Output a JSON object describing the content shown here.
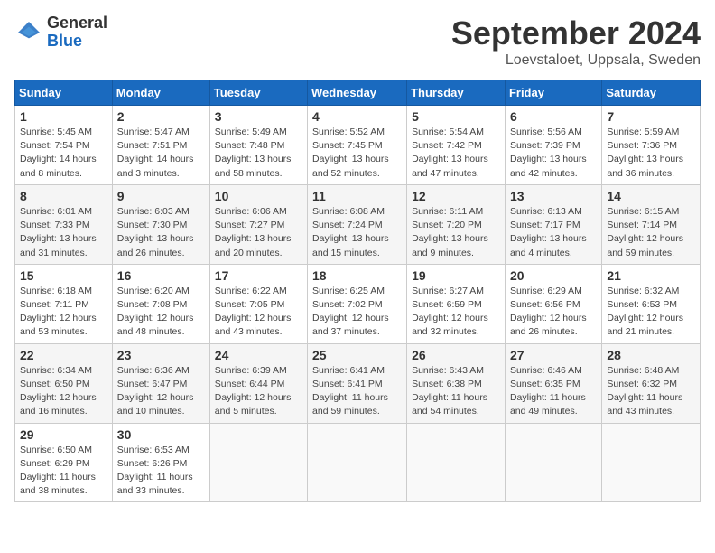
{
  "header": {
    "logo_line1": "General",
    "logo_line2": "Blue",
    "month_title": "September 2024",
    "location": "Loevstaloet, Uppsala, Sweden"
  },
  "calendar": {
    "days_of_week": [
      "Sunday",
      "Monday",
      "Tuesday",
      "Wednesday",
      "Thursday",
      "Friday",
      "Saturday"
    ],
    "weeks": [
      [
        {
          "day": "1",
          "info": "Sunrise: 5:45 AM\nSunset: 7:54 PM\nDaylight: 14 hours\nand 8 minutes."
        },
        {
          "day": "2",
          "info": "Sunrise: 5:47 AM\nSunset: 7:51 PM\nDaylight: 14 hours\nand 3 minutes."
        },
        {
          "day": "3",
          "info": "Sunrise: 5:49 AM\nSunset: 7:48 PM\nDaylight: 13 hours\nand 58 minutes."
        },
        {
          "day": "4",
          "info": "Sunrise: 5:52 AM\nSunset: 7:45 PM\nDaylight: 13 hours\nand 52 minutes."
        },
        {
          "day": "5",
          "info": "Sunrise: 5:54 AM\nSunset: 7:42 PM\nDaylight: 13 hours\nand 47 minutes."
        },
        {
          "day": "6",
          "info": "Sunrise: 5:56 AM\nSunset: 7:39 PM\nDaylight: 13 hours\nand 42 minutes."
        },
        {
          "day": "7",
          "info": "Sunrise: 5:59 AM\nSunset: 7:36 PM\nDaylight: 13 hours\nand 36 minutes."
        }
      ],
      [
        {
          "day": "8",
          "info": "Sunrise: 6:01 AM\nSunset: 7:33 PM\nDaylight: 13 hours\nand 31 minutes."
        },
        {
          "day": "9",
          "info": "Sunrise: 6:03 AM\nSunset: 7:30 PM\nDaylight: 13 hours\nand 26 minutes."
        },
        {
          "day": "10",
          "info": "Sunrise: 6:06 AM\nSunset: 7:27 PM\nDaylight: 13 hours\nand 20 minutes."
        },
        {
          "day": "11",
          "info": "Sunrise: 6:08 AM\nSunset: 7:24 PM\nDaylight: 13 hours\nand 15 minutes."
        },
        {
          "day": "12",
          "info": "Sunrise: 6:11 AM\nSunset: 7:20 PM\nDaylight: 13 hours\nand 9 minutes."
        },
        {
          "day": "13",
          "info": "Sunrise: 6:13 AM\nSunset: 7:17 PM\nDaylight: 13 hours\nand 4 minutes."
        },
        {
          "day": "14",
          "info": "Sunrise: 6:15 AM\nSunset: 7:14 PM\nDaylight: 12 hours\nand 59 minutes."
        }
      ],
      [
        {
          "day": "15",
          "info": "Sunrise: 6:18 AM\nSunset: 7:11 PM\nDaylight: 12 hours\nand 53 minutes."
        },
        {
          "day": "16",
          "info": "Sunrise: 6:20 AM\nSunset: 7:08 PM\nDaylight: 12 hours\nand 48 minutes."
        },
        {
          "day": "17",
          "info": "Sunrise: 6:22 AM\nSunset: 7:05 PM\nDaylight: 12 hours\nand 43 minutes."
        },
        {
          "day": "18",
          "info": "Sunrise: 6:25 AM\nSunset: 7:02 PM\nDaylight: 12 hours\nand 37 minutes."
        },
        {
          "day": "19",
          "info": "Sunrise: 6:27 AM\nSunset: 6:59 PM\nDaylight: 12 hours\nand 32 minutes."
        },
        {
          "day": "20",
          "info": "Sunrise: 6:29 AM\nSunset: 6:56 PM\nDaylight: 12 hours\nand 26 minutes."
        },
        {
          "day": "21",
          "info": "Sunrise: 6:32 AM\nSunset: 6:53 PM\nDaylight: 12 hours\nand 21 minutes."
        }
      ],
      [
        {
          "day": "22",
          "info": "Sunrise: 6:34 AM\nSunset: 6:50 PM\nDaylight: 12 hours\nand 16 minutes."
        },
        {
          "day": "23",
          "info": "Sunrise: 6:36 AM\nSunset: 6:47 PM\nDaylight: 12 hours\nand 10 minutes."
        },
        {
          "day": "24",
          "info": "Sunrise: 6:39 AM\nSunset: 6:44 PM\nDaylight: 12 hours\nand 5 minutes."
        },
        {
          "day": "25",
          "info": "Sunrise: 6:41 AM\nSunset: 6:41 PM\nDaylight: 11 hours\nand 59 minutes."
        },
        {
          "day": "26",
          "info": "Sunrise: 6:43 AM\nSunset: 6:38 PM\nDaylight: 11 hours\nand 54 minutes."
        },
        {
          "day": "27",
          "info": "Sunrise: 6:46 AM\nSunset: 6:35 PM\nDaylight: 11 hours\nand 49 minutes."
        },
        {
          "day": "28",
          "info": "Sunrise: 6:48 AM\nSunset: 6:32 PM\nDaylight: 11 hours\nand 43 minutes."
        }
      ],
      [
        {
          "day": "29",
          "info": "Sunrise: 6:50 AM\nSunset: 6:29 PM\nDaylight: 11 hours\nand 38 minutes."
        },
        {
          "day": "30",
          "info": "Sunrise: 6:53 AM\nSunset: 6:26 PM\nDaylight: 11 hours\nand 33 minutes."
        },
        {
          "day": "",
          "info": ""
        },
        {
          "day": "",
          "info": ""
        },
        {
          "day": "",
          "info": ""
        },
        {
          "day": "",
          "info": ""
        },
        {
          "day": "",
          "info": ""
        }
      ]
    ]
  }
}
